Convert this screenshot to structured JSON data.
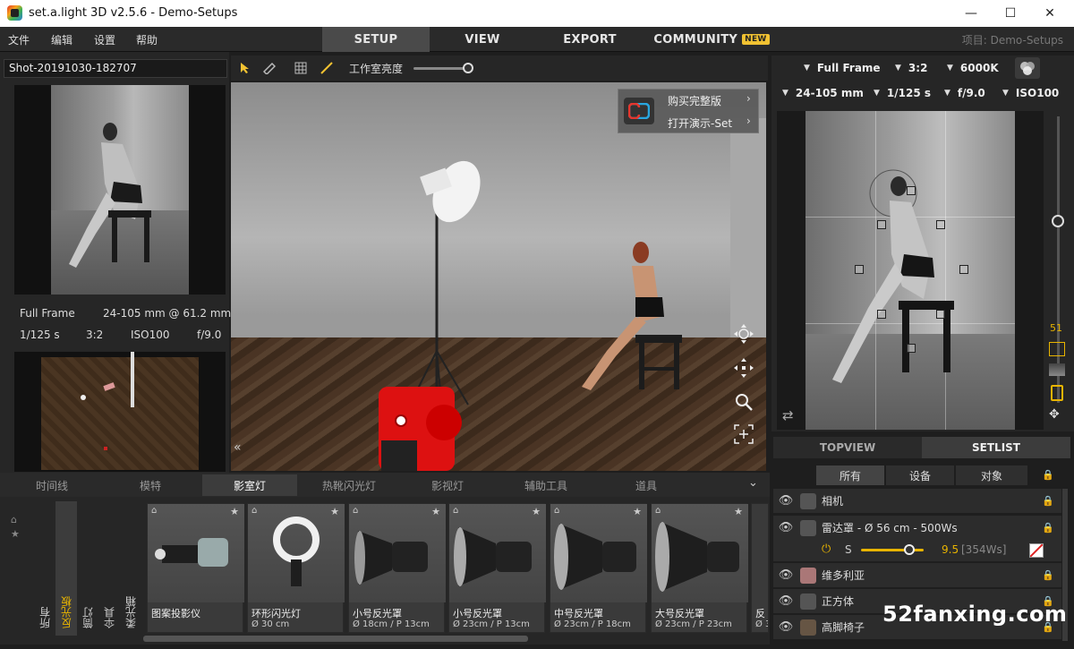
{
  "window": {
    "title": "set.a.light 3D v2.5.6 - Demo-Setups",
    "minimize": "—",
    "maximize": "☐",
    "close": "✕"
  },
  "menu": {
    "file": "文件",
    "edit": "编辑",
    "settings": "设置",
    "help": "帮助"
  },
  "nav": {
    "setup": "SETUP",
    "view": "VIEW",
    "export": "EXPORT",
    "community": "COMMUNITY",
    "new_badge": "NEW",
    "project": "项目: Demo-Setups"
  },
  "left": {
    "shot_name": "Shot-20191030-182707",
    "sensor": "Full Frame",
    "lens": "24-105 mm @ 61.2 mm",
    "shutter": "1/125 s",
    "ratio": "3:2",
    "iso": "ISO100",
    "aperture": "f/9.0"
  },
  "toolbar": {
    "brightness_label": "工作室亮度",
    "brightness_value": 0.95
  },
  "viewport": {
    "buy_full": "购买完整版",
    "open_demo": "打开演示-Set"
  },
  "right": {
    "sensor": "Full Frame",
    "ratio": "3:2",
    "wb": "6000K",
    "lens": "24-105 mm",
    "shutter": "1/125 s",
    "aperture": "f/9.0",
    "iso": "ISO100",
    "side_value": "51"
  },
  "right_tabs": {
    "topview": "TOPVIEW",
    "setlist": "SETLIST"
  },
  "set_filter": {
    "all": "所有",
    "device": "设备",
    "object": "对象"
  },
  "setlist": [
    {
      "label": "相机"
    },
    {
      "label": "雷达罩 - Ø 56 cm - 500Ws"
    },
    {
      "label": "维多利亚"
    },
    {
      "label": "正方体"
    },
    {
      "label": "高脚椅子"
    }
  ],
  "light_power": {
    "s_label": "S",
    "value": "9.5",
    "ws": "[354Ws]",
    "level": 0.78
  },
  "bottom_tabs": [
    "时间线",
    "模特",
    "影室灯",
    "热靴闪光灯",
    "影视灯",
    "辅助工具",
    "道具"
  ],
  "categories": [
    "所有",
    "反光板",
    "筒灯",
    "伞具",
    "柔光箱"
  ],
  "cards": [
    {
      "name": "图案投影仪",
      "size": ""
    },
    {
      "name": "环形闪光灯",
      "size": "Ø 30 cm"
    },
    {
      "name": "小号反光罩",
      "size": "Ø 18cm / P 13cm"
    },
    {
      "name": "小号反光罩",
      "size": "Ø 23cm / P 13cm"
    },
    {
      "name": "中号反光罩",
      "size": "Ø 23cm / P 18cm"
    },
    {
      "name": "大号反光罩",
      "size": "Ø 23cm / P 23cm"
    },
    {
      "name": "反",
      "size": "Ø 3"
    }
  ],
  "watermark": "52fanxing.com",
  "colors": {
    "accent": "#f1c232",
    "power": "#e8b400",
    "wb_ring": "#ffffff"
  }
}
